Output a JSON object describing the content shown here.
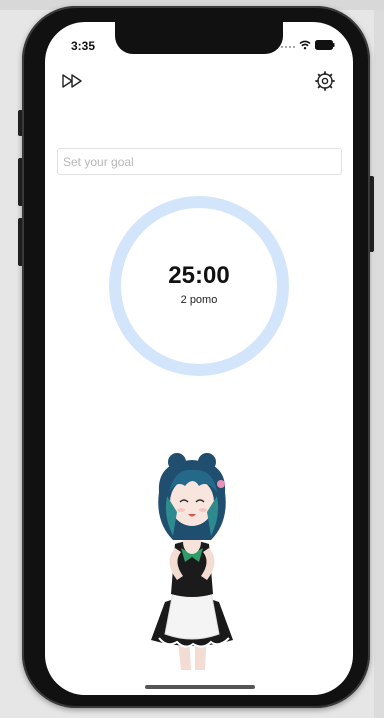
{
  "status_bar": {
    "time": "3:35"
  },
  "toolbar": {
    "skip_icon": "fast-forward-icon",
    "settings_icon": "gear-icon"
  },
  "goal": {
    "placeholder": "Set your goal",
    "value": ""
  },
  "timer": {
    "time": "25:00",
    "sub": "2 pomo",
    "ring_color": "#d3e5fb"
  },
  "character": {
    "description_icon": "anime-maid-character"
  }
}
